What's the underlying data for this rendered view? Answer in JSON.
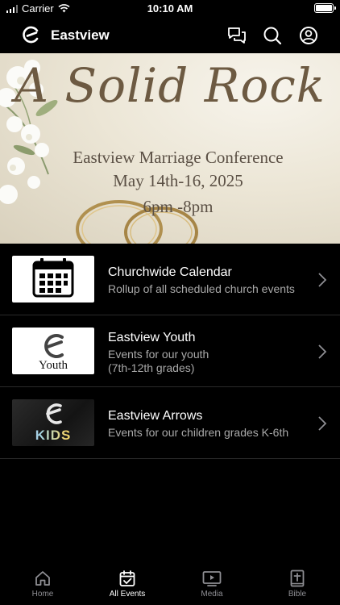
{
  "status_bar": {
    "carrier": "Carrier",
    "time": "10:10 AM"
  },
  "nav": {
    "title": "Eastview"
  },
  "hero": {
    "title": "A Solid Rock",
    "line1": "Eastview Marriage Conference",
    "line2": "May 14th-16, 2025",
    "line3": "6pm -8pm"
  },
  "events": [
    {
      "title": "Churchwide Calendar",
      "subtitle": "Rollup of all scheduled church events"
    },
    {
      "title": "Eastview Youth",
      "subtitle_line1": "Events for our youth",
      "subtitle_line2": "(7th-12th grades)",
      "thumb_text": "Youth"
    },
    {
      "title": "Eastview Arrows",
      "subtitle": "Events for our children grades K-6th",
      "thumb_text": "KIDS"
    }
  ],
  "tabs": [
    {
      "label": "Home",
      "icon": "home-icon"
    },
    {
      "label": "All Events",
      "icon": "calendar-check-icon"
    },
    {
      "label": "Media",
      "icon": "tv-play-icon"
    },
    {
      "label": "Bible",
      "icon": "bible-icon"
    }
  ],
  "active_tab": "All Events"
}
